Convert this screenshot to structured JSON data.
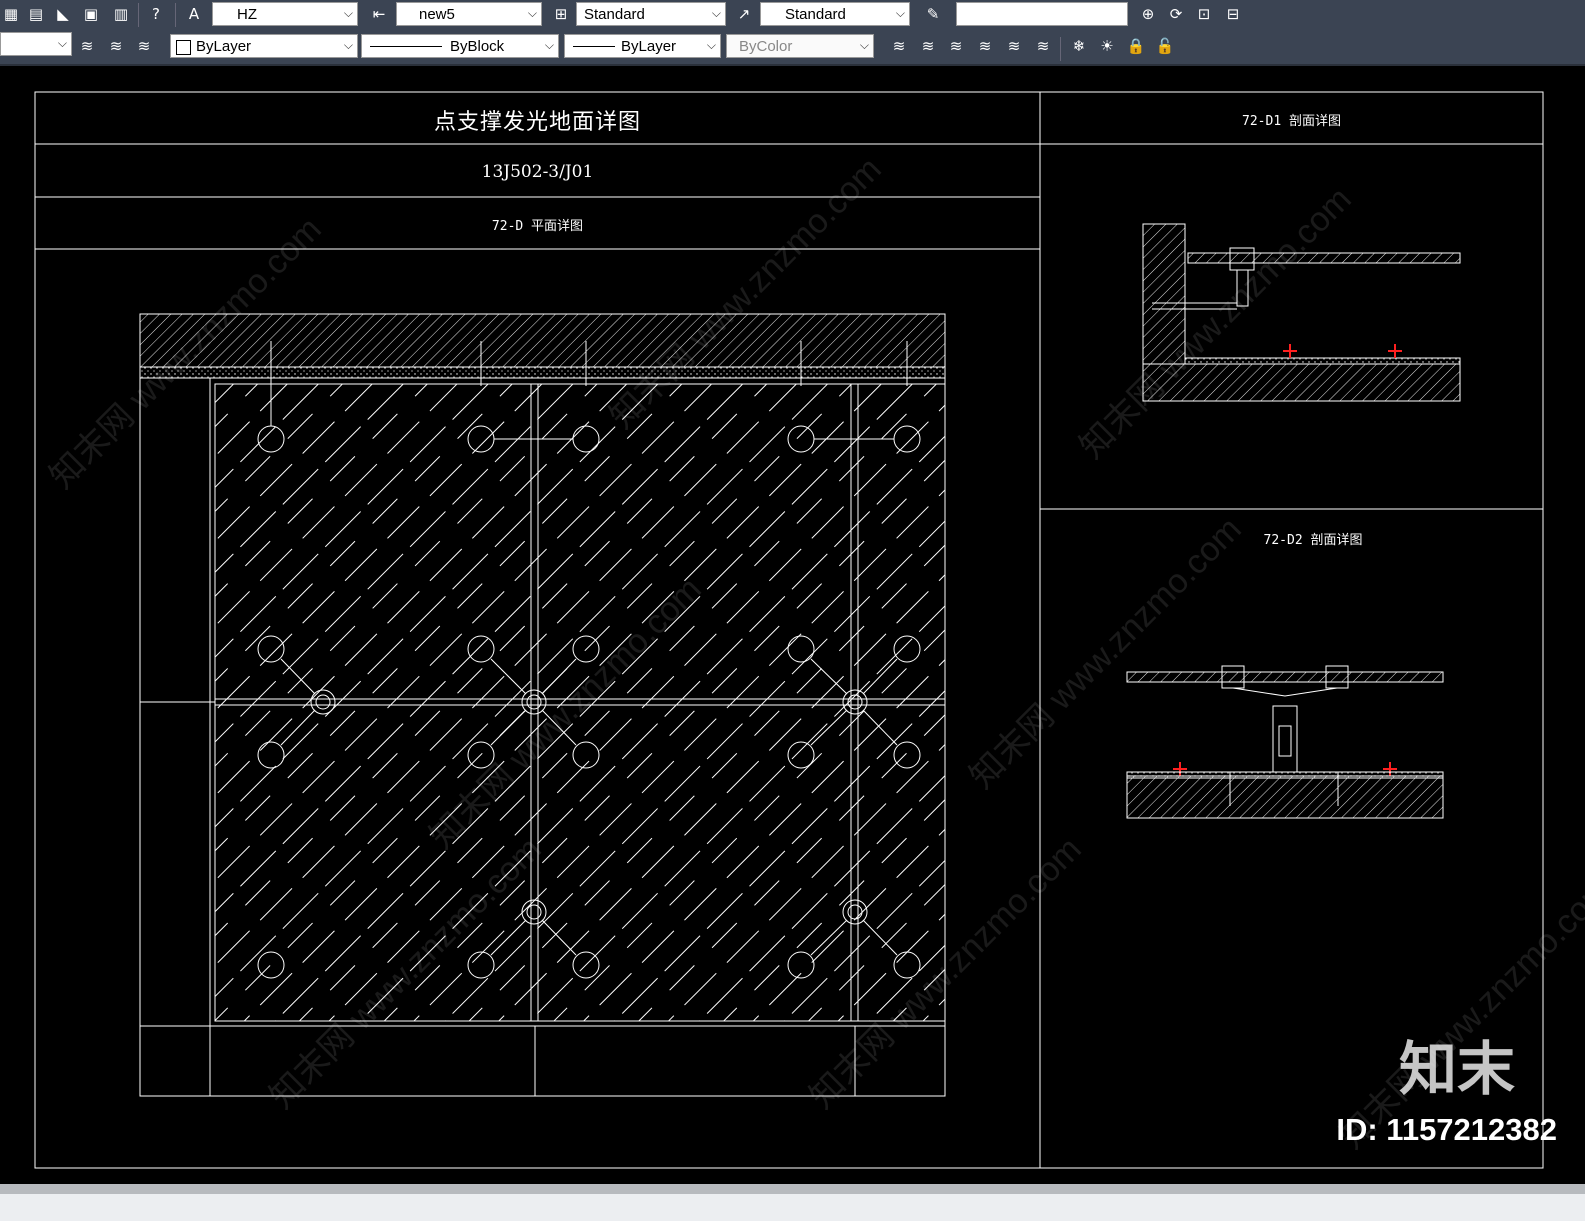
{
  "toolbar_row1": {
    "text_style_combo": "HZ",
    "dim_style_combo": "new5",
    "table_style_combo": "Standard",
    "mleader_style_combo": "Standard",
    "empty_combo": ""
  },
  "toolbar_row2": {
    "layer_combo": "",
    "color_combo": "ByLayer",
    "linetype_combo": "ByBlock",
    "lineweight_combo": "ByLayer",
    "plotstyle_combo": "ByColor"
  },
  "drawing": {
    "main_title": "点支撑发光地面详图",
    "code": "13J502-3/J01",
    "plan_title": "72-D 平面详图",
    "section1_title": "72-D1 剖面详图",
    "section2_title": "72-D2  剖面详图"
  },
  "watermark": {
    "text": "知末网 www.znzmo.com",
    "brand": "知末",
    "image_id": "ID: 1157212382"
  },
  "colors": {
    "toolbar_bg": "#3b4453",
    "canvas_bg": "#000000",
    "line": "#ffffff",
    "marker": "#ff2020"
  }
}
